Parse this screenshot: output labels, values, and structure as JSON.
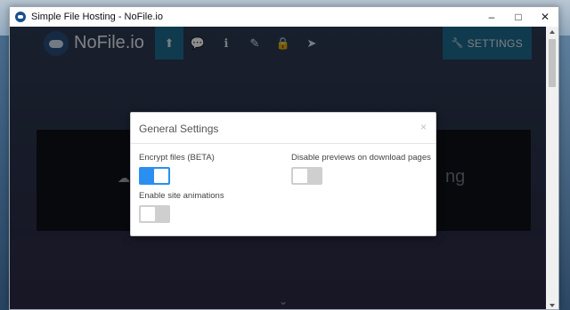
{
  "window": {
    "title": "Simple File Hosting - NoFile.io",
    "minimize": "–",
    "maximize": "□",
    "close": "✕"
  },
  "navbar": {
    "logo_text": "NoFile.io",
    "icons": [
      {
        "name": "upload-icon",
        "glyph": "⬆",
        "active": true
      },
      {
        "name": "chat-icon",
        "glyph": "💬"
      },
      {
        "name": "info-icon",
        "glyph": "ℹ"
      },
      {
        "name": "pencil-icon",
        "glyph": "✎"
      },
      {
        "name": "lock-icon",
        "glyph": "🔒"
      },
      {
        "name": "send-icon",
        "glyph": "➤"
      }
    ],
    "settings_label": "SETTINGS",
    "accent": "#1e6a8e"
  },
  "background": {
    "partial_text": "ng"
  },
  "modal": {
    "title": "General Settings",
    "close": "×",
    "settings": [
      {
        "label": "Encrypt files (BETA)",
        "on": true
      },
      {
        "label": "Disable previews on download pages",
        "on": false
      },
      {
        "label": "Enable site animations",
        "on": false
      }
    ],
    "toggle_on_color": "#2a8ff0"
  }
}
